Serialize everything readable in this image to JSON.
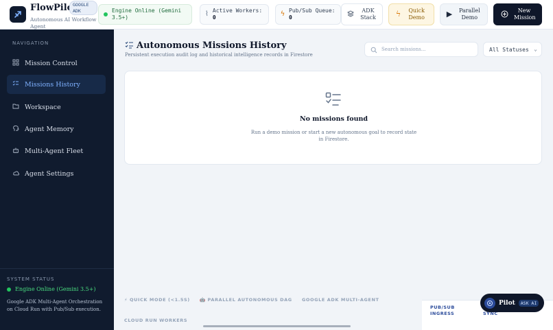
{
  "header": {
    "brand": "FlowPilot",
    "badge_line1": "GOOGLE",
    "badge_line2": "ADK",
    "tagline": "Autonomous AI Workflow Agent",
    "engine_status": "Engine Online (Gemini 3.5+)",
    "active_workers_label": "Active Workers:",
    "active_workers_value": "0",
    "pubsub_label": "Pub/Sub Queue:",
    "pubsub_value": "0",
    "adk_stack_label": "ADK Stack",
    "quick_demo_label": "Quick Demo",
    "parallel_demo_label": "Parallel Demo",
    "new_mission_label": "New Mission"
  },
  "sidebar": {
    "title": "NAVIGATION",
    "items": [
      {
        "label": "Mission Control",
        "icon": "grid-icon"
      },
      {
        "label": "Missions History",
        "icon": "list-check-icon"
      },
      {
        "label": "Workspace",
        "icon": "folder-icon"
      },
      {
        "label": "Agent Memory",
        "icon": "brain-icon"
      },
      {
        "label": "Multi-Agent Fleet",
        "icon": "robot-icon"
      },
      {
        "label": "Agent Settings",
        "icon": "cloud-icon"
      }
    ],
    "active_index": 1,
    "system_title": "SYSTEM STATUS",
    "system_status": "Engine Online (Gemini 3.5+)",
    "system_desc": "Google ADK Multi-Agent Orchestration on Cloud Run with Pub/Sub execution."
  },
  "main": {
    "title": "Autonomous Missions History",
    "subtitle": "Persistent execution audit log and historical intelligence records in Firestore",
    "search_placeholder": "Search missions...",
    "status_filter": "All Statuses",
    "empty_title": "No missions found",
    "empty_desc": "Run a demo mission or start a new autonomous goal to record state in Firestore."
  },
  "footer": {
    "tag1": "⚡ QUICK MODE (<1.5S)",
    "tag2": "🤖 PARALLEL AUTONOMOUS DAG",
    "tag3": "GOOGLE ADK MULTI-AGENT",
    "tag4": "CLOUD RUN WORKERS",
    "link1_line1": "PUB/SUB",
    "link1_line2": "INGRESS",
    "link2": "SYNC"
  },
  "pilot": {
    "label": "Pilot",
    "badge": "ASK AI"
  },
  "colors": {
    "sidebar_bg": "#101b2e",
    "accent": "#7fb1ff",
    "online": "#22c55e",
    "primary_button": "#0f172a"
  }
}
